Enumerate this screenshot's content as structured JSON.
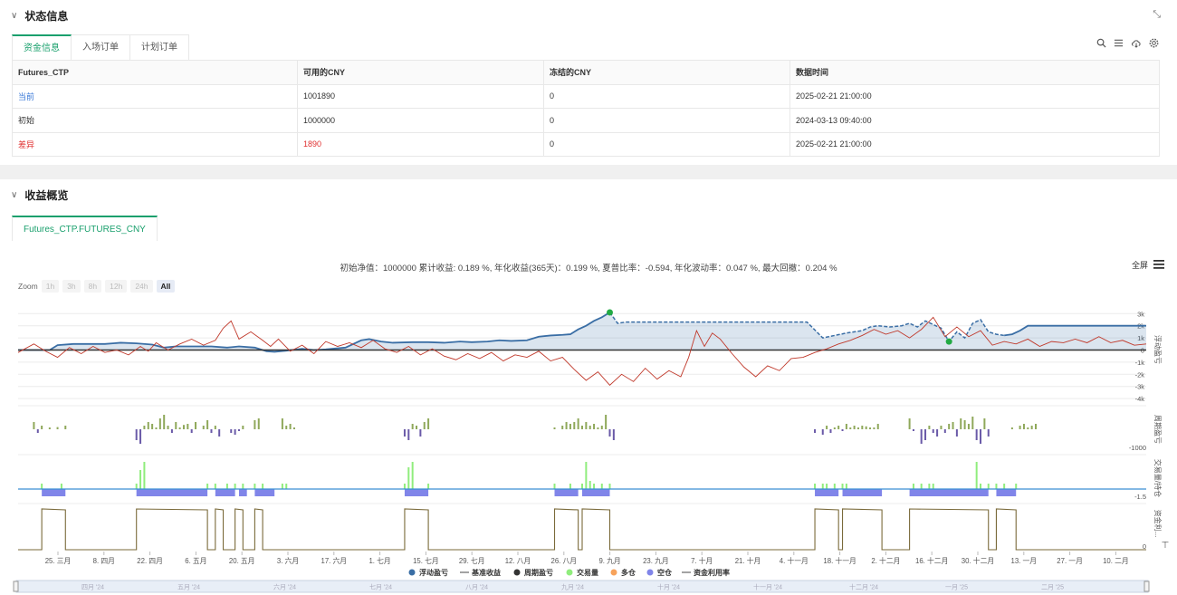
{
  "status": {
    "title": "状态信息",
    "tabs": [
      "资金信息",
      "入场订单",
      "计划订单"
    ],
    "table": {
      "headers": [
        "Futures_CTP",
        "可用的CNY",
        "冻结的CNY",
        "数据时间"
      ],
      "rows": [
        {
          "label": "当前",
          "available": "1001890",
          "frozen": "0",
          "time": "2025-02-21 21:00:00"
        },
        {
          "label": "初始",
          "available": "1000000",
          "frozen": "0",
          "time": "2024-03-13 09:40:00"
        },
        {
          "label": "差异",
          "available": "1890",
          "frozen": "0",
          "time": "2025-02-21 21:00:00"
        }
      ]
    }
  },
  "perf": {
    "title": "收益概览",
    "tab": "Futures_CTP.FUTURES_CNY",
    "summary": "初始净值：1000000 累计收益: 0.189 %, 年化收益(365天)：0.199 %, 夏普比率：-0.594, 年化波动率：0.047 %, 最大回撤：0.204 %",
    "fullscreen": "全屏",
    "zoom": {
      "label": "Zoom",
      "buttons": [
        "1h",
        "3h",
        "8h",
        "12h",
        "24h",
        "All"
      ],
      "selected": "All"
    }
  },
  "chart_data": {
    "type": "line",
    "x_labels": [
      "25. 三月",
      "8. 四月",
      "22. 四月",
      "6. 五月",
      "20. 五月",
      "3. 六月",
      "17. 六月",
      "1. 七月",
      "15. 七月",
      "29. 七月",
      "12. 八月",
      "26. 八月",
      "9. 九月",
      "23. 九月",
      "7. 十月",
      "21. 十月",
      "4. 十一月",
      "18. 十一月",
      "2. 十二月",
      "16. 十二月",
      "30. 十二月",
      "13. 一月",
      "27. 一月",
      "10. 二月"
    ],
    "navigator_labels": [
      "四月 '24",
      "五月 '24",
      "六月 '24",
      "七月 '24",
      "八月 '24",
      "九月 '24",
      "十月 '24",
      "十一月 '24",
      "十二月 '24",
      "一月 '25",
      "二月 '25"
    ],
    "panes": [
      {
        "name": "浮动盈亏",
        "y_ticks": [
          "3k",
          "2k",
          "1k",
          "0",
          "-1k",
          "-2k",
          "-3k",
          "-4k"
        ]
      },
      {
        "name": "周期盈亏",
        "y_ticks": [
          "-1000"
        ]
      },
      {
        "name": "交易量/持仓",
        "y_ticks": [
          "-1.5"
        ]
      },
      {
        "name": "资金利...",
        "y_ticks": [
          "0"
        ]
      }
    ],
    "legend": [
      {
        "name": "浮动盈亏",
        "color": "#3a6ea5",
        "shape": "dot"
      },
      {
        "name": "基准收益",
        "color": "#666666",
        "shape": "line"
      },
      {
        "name": "周期盈亏",
        "color": "#333333",
        "shape": "dot"
      },
      {
        "name": "交易量",
        "color": "#90ed7d",
        "shape": "dot"
      },
      {
        "name": "多仓",
        "color": "#f7a35c",
        "shape": "dot"
      },
      {
        "name": "空仓",
        "color": "#8085e9",
        "shape": "dot"
      },
      {
        "name": "资金利用率",
        "color": "#666666",
        "shape": "line"
      }
    ],
    "profit_series": [
      [
        0,
        0
      ],
      [
        8,
        0
      ],
      [
        10,
        400
      ],
      [
        14,
        500
      ],
      [
        22,
        500
      ],
      [
        26,
        600
      ],
      [
        30,
        550
      ],
      [
        34,
        450
      ],
      [
        37,
        200
      ],
      [
        40,
        300
      ],
      [
        44,
        300
      ],
      [
        49,
        300
      ],
      [
        53,
        200
      ],
      [
        56,
        300
      ],
      [
        60,
        200
      ],
      [
        63,
        -100
      ],
      [
        65,
        -150
      ],
      [
        68,
        -50
      ],
      [
        72,
        100
      ],
      [
        75,
        0
      ],
      [
        78,
        50
      ],
      [
        83,
        200
      ],
      [
        87,
        800
      ],
      [
        89,
        900
      ],
      [
        92,
        700
      ],
      [
        95,
        600
      ],
      [
        100,
        650
      ],
      [
        104,
        650
      ],
      [
        108,
        600
      ],
      [
        112,
        700
      ],
      [
        115,
        650
      ],
      [
        119,
        700
      ],
      [
        122,
        800
      ],
      [
        125,
        750
      ],
      [
        129,
        800
      ],
      [
        132,
        1100
      ],
      [
        135,
        1200
      ],
      [
        138,
        1250
      ],
      [
        140,
        1300
      ],
      [
        142,
        1700
      ],
      [
        144,
        2000
      ],
      [
        146,
        2400
      ],
      [
        148,
        2700
      ],
      [
        149,
        2900
      ],
      [
        150,
        3100
      ],
      [
        152,
        2200
      ],
      [
        154,
        2300
      ],
      [
        160,
        2300
      ],
      [
        168,
        2300
      ],
      [
        176,
        2300
      ],
      [
        185,
        2300
      ],
      [
        193,
        2300
      ],
      [
        200,
        2300
      ],
      [
        204,
        1000
      ],
      [
        207,
        1200
      ],
      [
        210,
        1400
      ],
      [
        214,
        1600
      ],
      [
        216,
        1900
      ],
      [
        218,
        2000
      ],
      [
        221,
        1900
      ],
      [
        224,
        2000
      ],
      [
        226,
        2200
      ],
      [
        228,
        1900
      ],
      [
        230,
        2400
      ],
      [
        232,
        2100
      ],
      [
        234,
        1800
      ],
      [
        236,
        700
      ],
      [
        238,
        1500
      ],
      [
        240,
        1000
      ],
      [
        242,
        2200
      ],
      [
        244,
        2500
      ],
      [
        246,
        1500
      ],
      [
        248,
        1300
      ],
      [
        250,
        1200
      ],
      [
        252,
        1300
      ],
      [
        254,
        1600
      ],
      [
        256,
        2000
      ],
      [
        258,
        2000
      ],
      [
        262,
        2000
      ],
      [
        266,
        2000
      ],
      [
        270,
        2000
      ],
      [
        274,
        2000
      ],
      [
        278,
        2000
      ],
      [
        282,
        2000
      ],
      [
        286,
        2000
      ]
    ],
    "profit_dashed_range": [
      150,
      250
    ],
    "benchmark_series": [
      [
        0,
        -200
      ],
      [
        4,
        500
      ],
      [
        7,
        -100
      ],
      [
        10,
        -600
      ],
      [
        13,
        200
      ],
      [
        16,
        -300
      ],
      [
        19,
        300
      ],
      [
        22,
        -200
      ],
      [
        25,
        0
      ],
      [
        28,
        -400
      ],
      [
        31,
        300
      ],
      [
        33,
        -100
      ],
      [
        35,
        600
      ],
      [
        38,
        0
      ],
      [
        41,
        500
      ],
      [
        44,
        900
      ],
      [
        47,
        400
      ],
      [
        50,
        800
      ],
      [
        52,
        1800
      ],
      [
        54,
        2400
      ],
      [
        56,
        900
      ],
      [
        59,
        1500
      ],
      [
        62,
        800
      ],
      [
        64,
        300
      ],
      [
        66,
        900
      ],
      [
        69,
        -100
      ],
      [
        72,
        400
      ],
      [
        75,
        -300
      ],
      [
        78,
        700
      ],
      [
        81,
        300
      ],
      [
        84,
        600
      ],
      [
        87,
        200
      ],
      [
        90,
        800
      ],
      [
        93,
        100
      ],
      [
        96,
        -200
      ],
      [
        99,
        300
      ],
      [
        102,
        -400
      ],
      [
        105,
        100
      ],
      [
        108,
        -500
      ],
      [
        111,
        -800
      ],
      [
        114,
        -300
      ],
      [
        117,
        -700
      ],
      [
        120,
        -200
      ],
      [
        123,
        -900
      ],
      [
        126,
        -400
      ],
      [
        129,
        -600
      ],
      [
        132,
        -100
      ],
      [
        135,
        -900
      ],
      [
        138,
        -600
      ],
      [
        141,
        -1600
      ],
      [
        144,
        -2500
      ],
      [
        147,
        -1800
      ],
      [
        150,
        -2900
      ],
      [
        153,
        -2000
      ],
      [
        156,
        -2600
      ],
      [
        159,
        -1500
      ],
      [
        162,
        -2400
      ],
      [
        165,
        -1700
      ],
      [
        168,
        -2200
      ],
      [
        170,
        -600
      ],
      [
        172,
        1600
      ],
      [
        174,
        300
      ],
      [
        176,
        1400
      ],
      [
        178,
        900
      ],
      [
        181,
        -300
      ],
      [
        184,
        -1400
      ],
      [
        187,
        -2200
      ],
      [
        190,
        -1300
      ],
      [
        193,
        -1700
      ],
      [
        196,
        -700
      ],
      [
        199,
        -600
      ],
      [
        202,
        -200
      ],
      [
        205,
        100
      ],
      [
        208,
        500
      ],
      [
        211,
        800
      ],
      [
        214,
        1200
      ],
      [
        217,
        1700
      ],
      [
        220,
        1300
      ],
      [
        223,
        1600
      ],
      [
        226,
        1000
      ],
      [
        229,
        1700
      ],
      [
        232,
        2700
      ],
      [
        235,
        1100
      ],
      [
        238,
        1900
      ],
      [
        241,
        1100
      ],
      [
        244,
        1600
      ],
      [
        247,
        400
      ],
      [
        250,
        700
      ],
      [
        253,
        500
      ],
      [
        256,
        900
      ],
      [
        259,
        300
      ],
      [
        262,
        700
      ],
      [
        265,
        600
      ],
      [
        268,
        900
      ],
      [
        271,
        600
      ],
      [
        274,
        1100
      ],
      [
        277,
        600
      ],
      [
        280,
        800
      ],
      [
        283,
        400
      ],
      [
        286,
        500
      ]
    ],
    "markers": [
      {
        "x": 150,
        "y": 3100,
        "color": "#22aa44"
      },
      {
        "x": 236,
        "y": 700,
        "color": "#22aa44"
      }
    ],
    "period_bars": [
      [
        4,
        2
      ],
      [
        5,
        -1
      ],
      [
        6,
        1
      ],
      [
        8,
        0.5
      ],
      [
        10,
        0.6
      ],
      [
        12,
        1
      ],
      [
        30,
        -3
      ],
      [
        31,
        -4
      ],
      [
        32,
        1
      ],
      [
        33,
        2
      ],
      [
        34,
        1.5
      ],
      [
        35,
        0.5
      ],
      [
        36,
        3
      ],
      [
        37,
        4
      ],
      [
        38,
        1
      ],
      [
        39,
        -1
      ],
      [
        40,
        2
      ],
      [
        41,
        0.5
      ],
      [
        42,
        1.2
      ],
      [
        43,
        1.5
      ],
      [
        44,
        -1
      ],
      [
        45,
        2
      ],
      [
        47,
        1
      ],
      [
        48,
        2.5
      ],
      [
        49,
        -1
      ],
      [
        50,
        1
      ],
      [
        51,
        -2
      ],
      [
        54,
        -1
      ],
      [
        55,
        -1.5
      ],
      [
        56,
        -0.5
      ],
      [
        57,
        1
      ],
      [
        60,
        2.5
      ],
      [
        61,
        3
      ],
      [
        67,
        3
      ],
      [
        68,
        1
      ],
      [
        69,
        1.5
      ],
      [
        70,
        0.5
      ],
      [
        98,
        -2
      ],
      [
        99,
        -3
      ],
      [
        100,
        1.5
      ],
      [
        101,
        1
      ],
      [
        102,
        -2
      ],
      [
        103,
        2
      ],
      [
        104,
        3
      ],
      [
        136,
        0.5
      ],
      [
        138,
        1
      ],
      [
        139,
        2
      ],
      [
        140,
        1.5
      ],
      [
        141,
        2
      ],
      [
        142,
        3
      ],
      [
        143,
        1
      ],
      [
        144,
        2
      ],
      [
        145,
        1
      ],
      [
        146,
        1.5
      ],
      [
        147,
        0.5
      ],
      [
        148,
        1
      ],
      [
        149,
        4
      ],
      [
        150,
        -2
      ],
      [
        151,
        -3
      ],
      [
        202,
        -1
      ],
      [
        204,
        -1.5
      ],
      [
        205,
        1
      ],
      [
        206,
        -1
      ],
      [
        207,
        0.5
      ],
      [
        208,
        1
      ],
      [
        209,
        -0.5
      ],
      [
        210,
        1.5
      ],
      [
        211,
        0.5
      ],
      [
        212,
        1
      ],
      [
        213,
        0.5
      ],
      [
        214,
        1
      ],
      [
        215,
        0.8
      ],
      [
        216,
        0.5
      ],
      [
        217,
        0.5
      ],
      [
        218,
        1.5
      ],
      [
        226,
        3
      ],
      [
        227,
        -0.5
      ],
      [
        229,
        -4
      ],
      [
        230,
        -3
      ],
      [
        231,
        1
      ],
      [
        232,
        -1
      ],
      [
        233,
        -2
      ],
      [
        234,
        1
      ],
      [
        235,
        -1
      ],
      [
        236,
        1.5
      ],
      [
        237,
        2
      ],
      [
        238,
        -2
      ],
      [
        239,
        3
      ],
      [
        240,
        2.5
      ],
      [
        241,
        1.5
      ],
      [
        242,
        3.5
      ],
      [
        243,
        -3
      ],
      [
        244,
        -4
      ],
      [
        245,
        3
      ],
      [
        246,
        -2
      ],
      [
        252,
        0.5
      ],
      [
        254,
        1
      ],
      [
        255,
        1.5
      ],
      [
        256,
        0.5
      ],
      [
        257,
        1
      ],
      [
        258,
        1.5
      ]
    ],
    "volume_bars": [
      [
        6,
        1
      ],
      [
        11,
        1
      ],
      [
        30,
        1
      ],
      [
        31,
        3.5
      ],
      [
        32,
        5
      ],
      [
        48,
        1
      ],
      [
        50,
        1
      ],
      [
        53,
        1
      ],
      [
        55,
        1
      ],
      [
        57,
        1
      ],
      [
        60,
        1
      ],
      [
        62,
        1
      ],
      [
        67,
        1
      ],
      [
        68,
        1
      ],
      [
        98,
        1
      ],
      [
        99,
        4
      ],
      [
        100,
        5
      ],
      [
        104,
        1
      ],
      [
        136,
        1
      ],
      [
        140,
        1
      ],
      [
        143,
        1
      ],
      [
        144,
        5
      ],
      [
        145,
        1.5
      ],
      [
        146,
        1
      ],
      [
        148,
        1
      ],
      [
        150,
        1
      ],
      [
        202,
        1
      ],
      [
        204,
        1
      ],
      [
        205,
        1
      ],
      [
        207,
        1
      ],
      [
        209,
        1
      ],
      [
        210,
        1
      ],
      [
        227,
        1
      ],
      [
        229,
        1
      ],
      [
        231,
        1
      ],
      [
        232,
        1
      ],
      [
        243,
        5
      ],
      [
        244,
        1
      ],
      [
        246,
        1
      ],
      [
        248,
        1
      ],
      [
        250,
        1
      ],
      [
        253,
        1
      ]
    ],
    "short_ranges": [
      [
        6,
        12
      ],
      [
        30,
        48
      ],
      [
        50,
        55
      ],
      [
        56,
        58
      ],
      [
        60,
        65
      ],
      [
        98,
        104
      ],
      [
        136,
        142
      ],
      [
        143,
        150
      ],
      [
        202,
        208
      ],
      [
        209,
        219
      ],
      [
        226,
        246
      ],
      [
        248,
        253
      ]
    ],
    "utilization_ranges": [
      [
        6,
        12
      ],
      [
        30,
        48
      ],
      [
        50,
        52
      ],
      [
        55,
        57
      ],
      [
        60,
        62
      ],
      [
        98,
        104
      ],
      [
        136,
        142
      ],
      [
        143,
        150
      ],
      [
        202,
        208
      ],
      [
        209,
        219
      ],
      [
        226,
        246
      ],
      [
        248,
        253
      ]
    ]
  }
}
